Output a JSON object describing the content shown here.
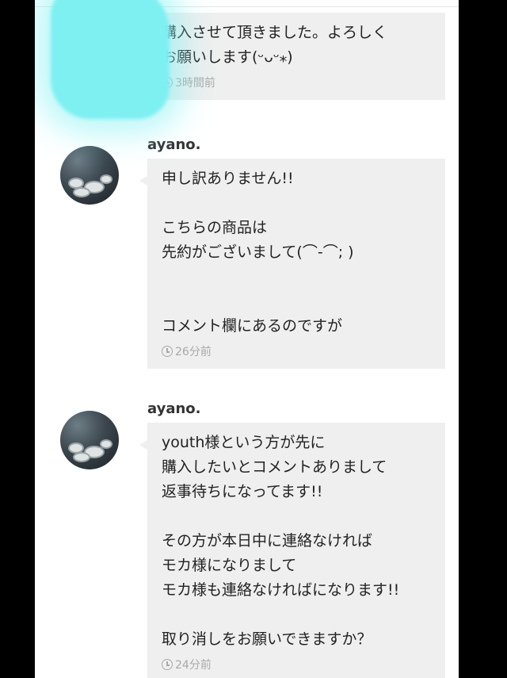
{
  "messages": [
    {
      "username": "",
      "lines": [
        "購入させて頂きました。よろしく",
        "お願いします(ᵕᴗᵕ⁎)"
      ],
      "time": "3時間前"
    },
    {
      "username": "ayano.",
      "lines": [
        "申し訳ありません!!",
        "",
        "こちらの商品は",
        "先約がございまして(⌒-⌒; )",
        "",
        "",
        "コメント欄にあるのですが"
      ],
      "time": "26分前"
    },
    {
      "username": "ayano.",
      "lines": [
        "youth様という方が先に",
        "購入したいとコメントありまして",
        "返事待ちになってます!!",
        "",
        "その方が本日中に連絡なければ",
        "モカ様になりまして",
        "モカ様も連絡なければになります!!",
        "",
        "取り消しをお願いできますか？"
      ],
      "time": "24分前"
    }
  ]
}
